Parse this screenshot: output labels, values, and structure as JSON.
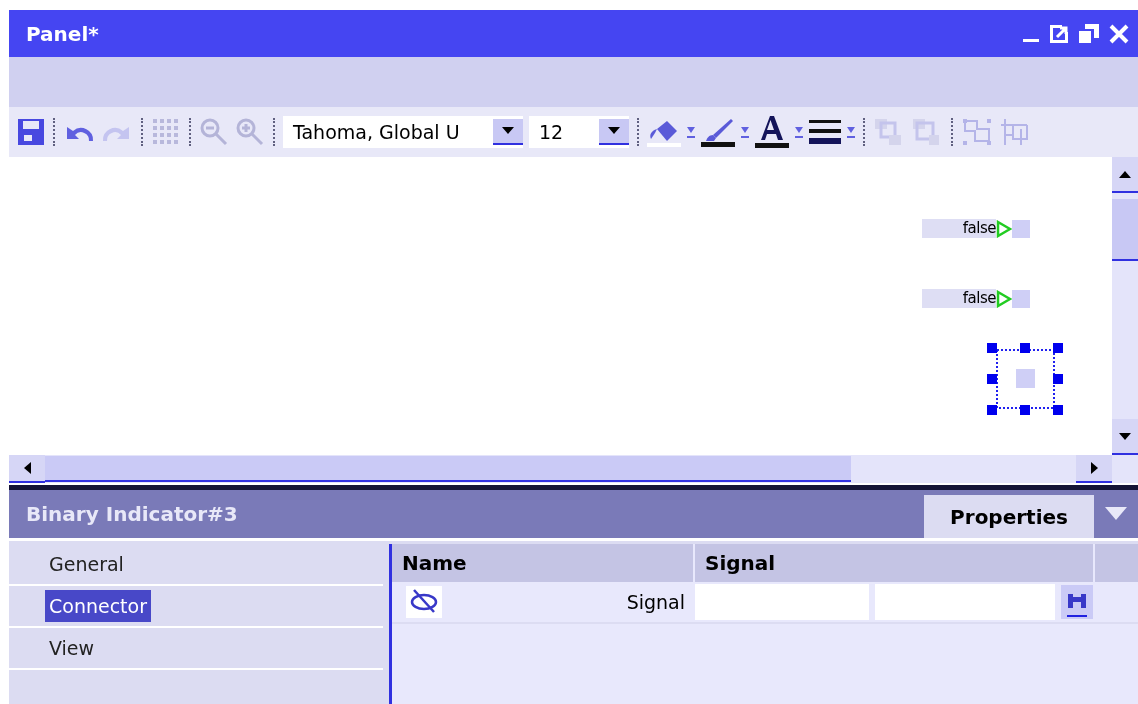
{
  "window": {
    "title": "Panel*"
  },
  "toolbar": {
    "font": "Tahoma, Global U",
    "size": "12"
  },
  "canvas": {
    "items": [
      {
        "kind": "indicator",
        "text": "false",
        "selected": false
      },
      {
        "kind": "indicator",
        "text": "false",
        "selected": false
      },
      {
        "kind": "indicator",
        "selected": true
      }
    ]
  },
  "properties": {
    "title": "Binary Indicator#3",
    "tab": "Properties",
    "nav": [
      {
        "label": "General",
        "selected": false
      },
      {
        "label": "Connector",
        "selected": true
      },
      {
        "label": "View",
        "selected": false
      }
    ],
    "columns": [
      "Name",
      "Signal"
    ],
    "rows": [
      {
        "name": "Signal"
      }
    ]
  }
}
